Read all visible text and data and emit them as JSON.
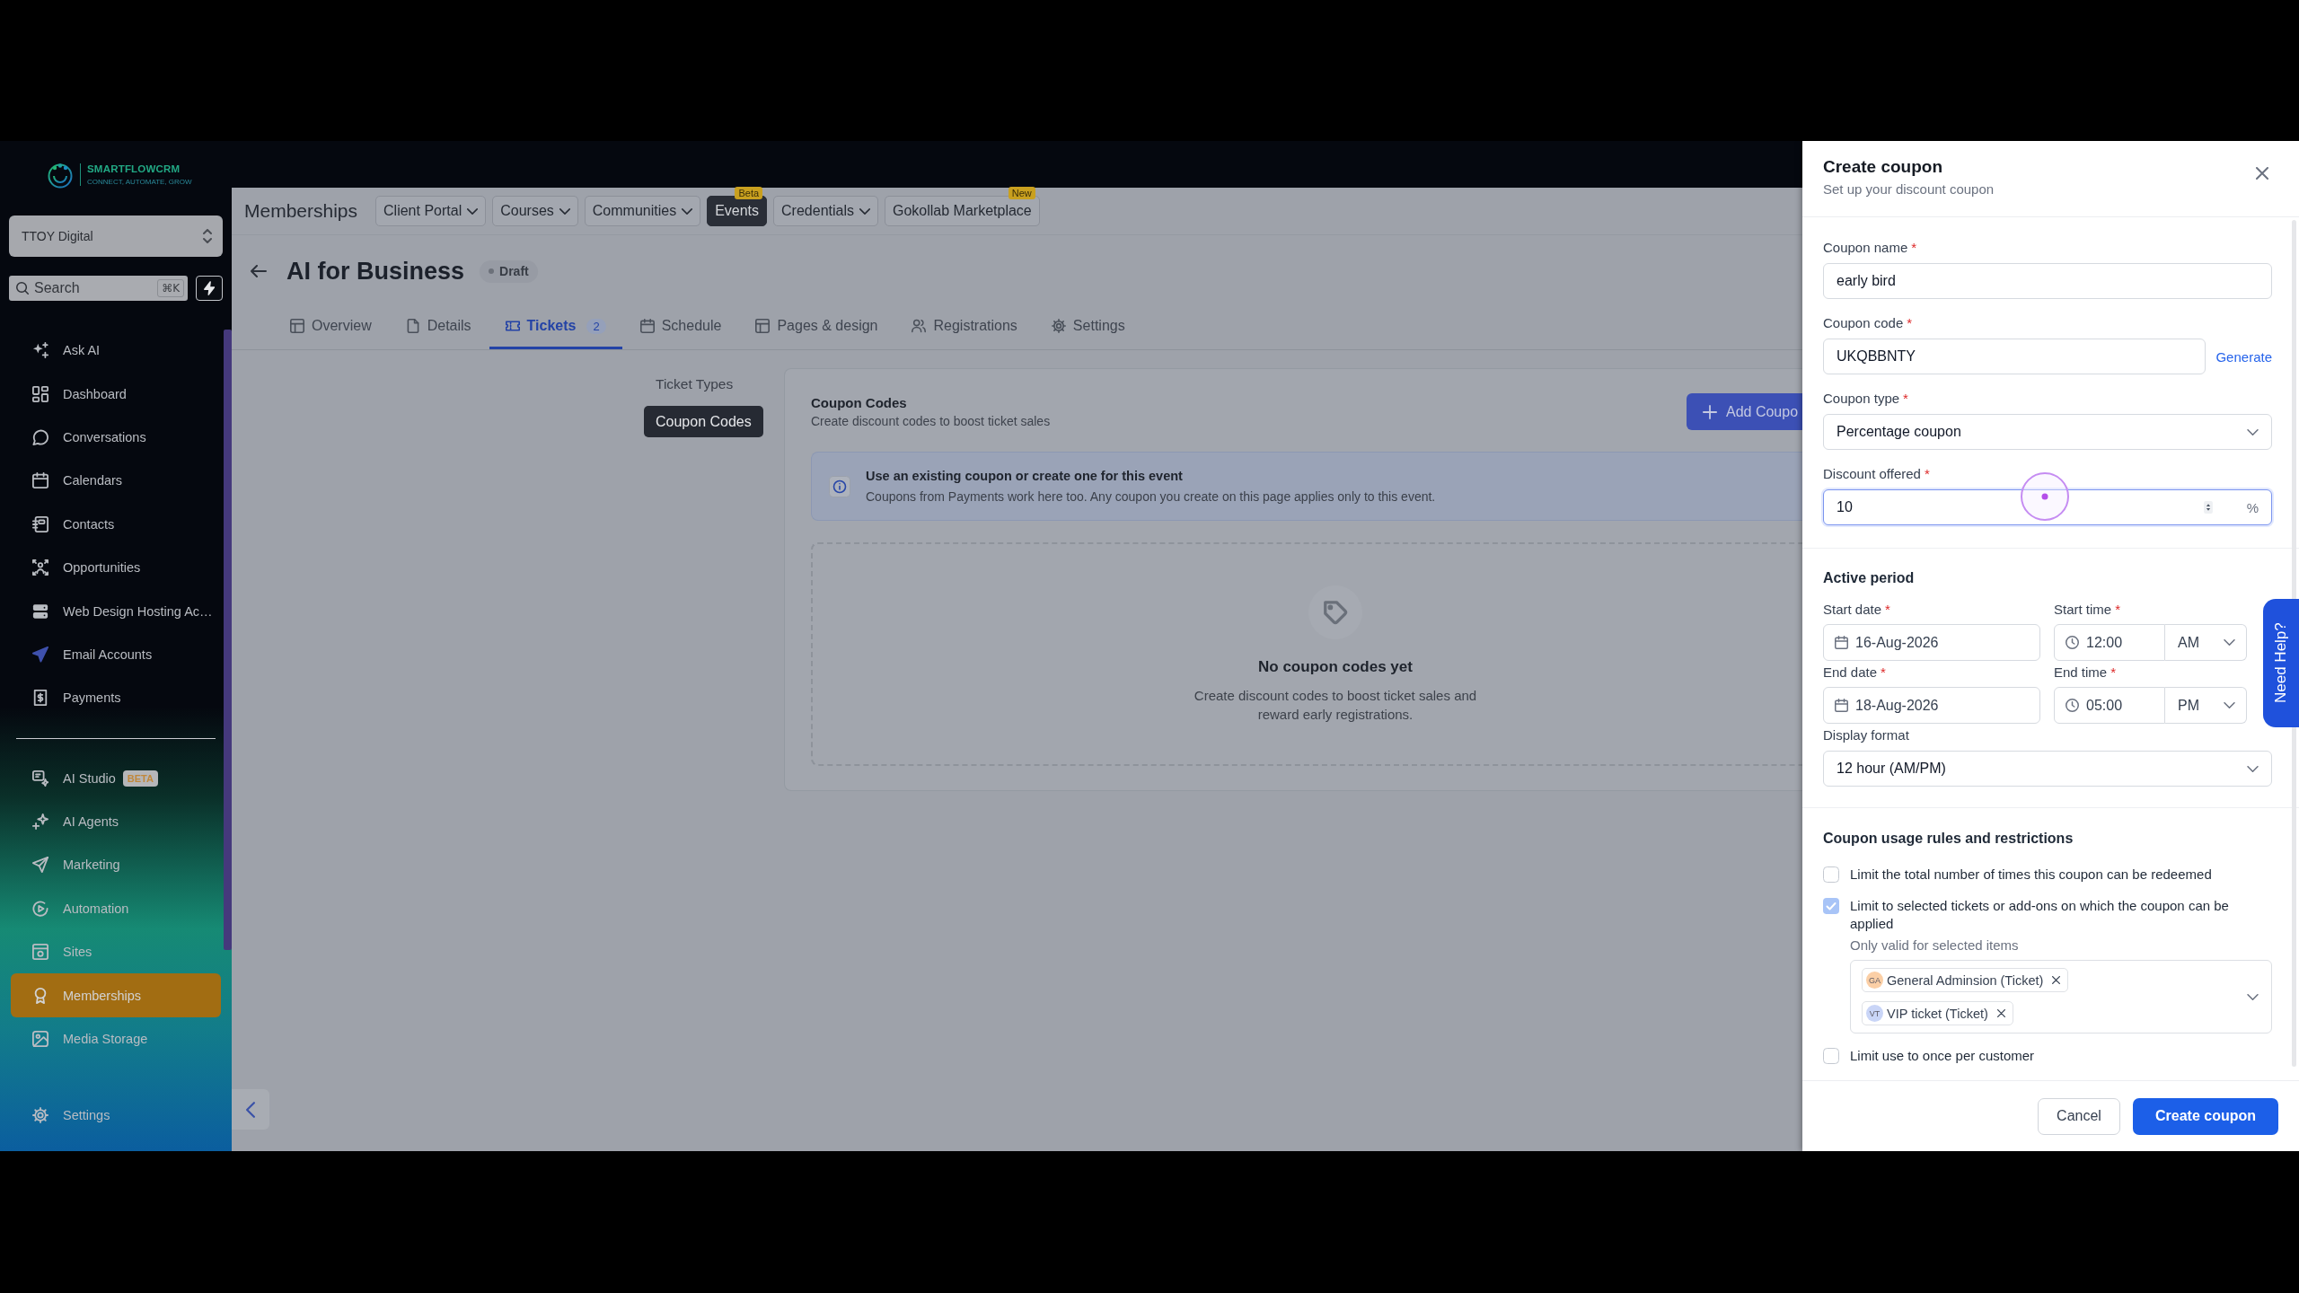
{
  "sidebar": {
    "logo": {
      "name": "SMARTFLOWCRM",
      "tagline": "CONNECT, AUTOMATE, GROW"
    },
    "account": "TTOY Digital",
    "search": {
      "placeholder": "Search",
      "shortcut": "⌘K"
    },
    "sections": [
      {
        "items": [
          {
            "label": "Ask AI",
            "selected": false
          },
          {
            "label": "Dashboard",
            "selected": false
          },
          {
            "label": "Conversations",
            "selected": false
          },
          {
            "label": "Calendars",
            "selected": false
          },
          {
            "label": "Contacts",
            "selected": false
          },
          {
            "label": "Opportunities",
            "selected": false
          },
          {
            "label": "Web Design Hosting Ac…",
            "selected": false
          },
          {
            "label": "Email Accounts",
            "selected": false
          },
          {
            "label": "Payments",
            "selected": false
          }
        ]
      },
      {
        "items": [
          {
            "label": "AI Studio",
            "badge": "BETA",
            "selected": false
          },
          {
            "label": "AI Agents",
            "selected": false
          },
          {
            "label": "Marketing",
            "selected": false
          },
          {
            "label": "Automation",
            "selected": false
          },
          {
            "label": "Sites",
            "selected": false
          },
          {
            "label": "Memberships",
            "selected": true
          },
          {
            "label": "Media Storage",
            "selected": false
          }
        ]
      }
    ],
    "bottom_item": {
      "label": "Settings"
    }
  },
  "topnav": {
    "title": "Memberships",
    "items": [
      {
        "label": "Client Portal",
        "dropdown": true,
        "selected": false
      },
      {
        "label": "Courses",
        "dropdown": true,
        "selected": false
      },
      {
        "label": "Communities",
        "dropdown": true,
        "selected": false
      },
      {
        "label": "Events",
        "dropdown": false,
        "selected": true,
        "badge": "Beta"
      },
      {
        "label": "Credentials",
        "dropdown": true,
        "selected": false
      },
      {
        "label": "Gokollab Marketplace",
        "dropdown": false,
        "selected": false,
        "badge": "New"
      }
    ]
  },
  "page": {
    "title": "AI for Business",
    "status": "Draft",
    "tabs": [
      {
        "label": "Overview",
        "selected": false
      },
      {
        "label": "Details",
        "selected": false
      },
      {
        "label": "Tickets",
        "count": "2",
        "selected": true
      },
      {
        "label": "Schedule",
        "selected": false
      },
      {
        "label": "Pages & design",
        "selected": false
      },
      {
        "label": "Registrations",
        "selected": false
      },
      {
        "label": "Settings",
        "selected": false
      }
    ]
  },
  "subnav": [
    {
      "label": "Ticket Types",
      "selected": false
    },
    {
      "label": "Coupon Codes",
      "selected": true
    }
  ],
  "coupons": {
    "title": "Coupon Codes",
    "subtitle": "Create discount codes to boost ticket sales",
    "add_button": "Add Coupo",
    "notice": {
      "title": "Use an existing coupon or create one for this event",
      "body": "Coupons from Payments work here too. Any coupon you create on this page applies only to this event."
    },
    "empty_state": {
      "title": "No coupon codes yet",
      "body": "Create discount codes to boost ticket sales and reward early registrations."
    }
  },
  "drawer": {
    "title": "Create coupon",
    "subtitle": "Set up your discount coupon",
    "fields": [
      {
        "kind": "text",
        "label": "Coupon name",
        "required_mark": "*",
        "value": "early bird",
        "focused": false
      },
      {
        "kind": "text",
        "label": "Coupon code",
        "required_mark": "*",
        "value": "UKQBBNTY",
        "action": "Generate",
        "focused": false
      },
      {
        "kind": "select",
        "label": "Coupon type",
        "required_mark": "*",
        "value": "Percentage coupon",
        "focused": false
      },
      {
        "kind": "number",
        "label": "Discount offered",
        "required_mark": "*",
        "value": "10",
        "suffix": "%",
        "focused": true
      }
    ],
    "active_period": {
      "title": "Active period",
      "rows": [
        {
          "date": {
            "label": "Start date",
            "required_mark": "*",
            "value": "16-Aug-2026"
          },
          "time": {
            "label": "Start time",
            "required_mark": "*",
            "value": "12:00",
            "meridiem": "AM"
          }
        },
        {
          "date": {
            "label": "End date",
            "required_mark": "*",
            "value": "18-Aug-2026"
          },
          "time": {
            "label": "End time",
            "required_mark": "*",
            "value": "05:00",
            "meridiem": "PM"
          }
        }
      ],
      "display_format": {
        "label": "Display format",
        "value": "12 hour (AM/PM)"
      }
    },
    "rules": {
      "title": "Coupon usage rules and restrictions",
      "items": [
        {
          "label": "Limit the total number of times this coupon can be redeemed",
          "checked": false
        },
        {
          "label": "Limit to selected tickets or add-ons on which the coupon can be applied",
          "checked": true,
          "hint": "Only valid for selected items",
          "chips": [
            {
              "initials": "GA",
              "label": "General Adminsion (Ticket)",
              "color": "#fbcfa6"
            },
            {
              "initials": "VT",
              "label": "VIP ticket (Ticket)",
              "color": "#c9d5f7"
            }
          ]
        },
        {
          "label": "Limit use to once per customer",
          "checked": false
        }
      ]
    },
    "buttons": [
      {
        "label": "Cancel",
        "kind": "secondary"
      },
      {
        "label": "Create coupon",
        "kind": "primary"
      }
    ],
    "help_tab": "Need Help?"
  }
}
